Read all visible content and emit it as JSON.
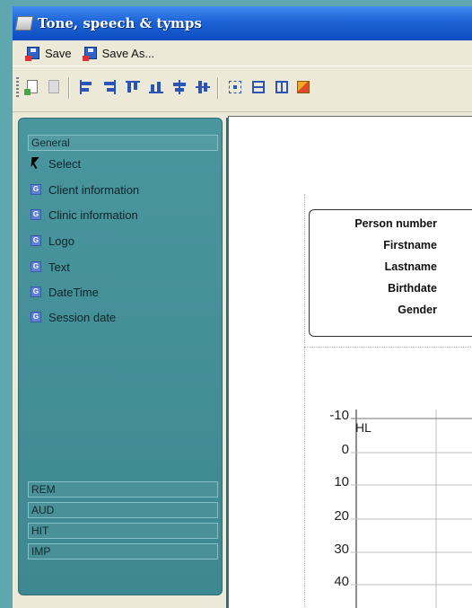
{
  "window": {
    "title": "Tone, speech & tymps"
  },
  "menu": {
    "save_label": "Save",
    "save_as_label": "Save As..."
  },
  "toolbar": {
    "buttons": [
      "new-document-icon",
      "disabled-document-icon",
      "align-left-icon",
      "align-right-icon",
      "align-top-icon",
      "align-bottom-icon",
      "center-horizontal-icon",
      "center-vertical-icon",
      "select-region-icon",
      "grid-icon",
      "columns-icon",
      "color-icon"
    ]
  },
  "panel": {
    "general_header": "General",
    "items": [
      {
        "label": "Select",
        "icon": "pointer-arrow-icon"
      },
      {
        "label": "Client information",
        "icon": "g-icon"
      },
      {
        "label": "Clinic information",
        "icon": "g-icon"
      },
      {
        "label": "Logo",
        "icon": "g-icon"
      },
      {
        "label": "Text",
        "icon": "g-icon"
      },
      {
        "label": "DateTime",
        "icon": "g-icon"
      },
      {
        "label": "Session date",
        "icon": "g-icon"
      }
    ],
    "groups": [
      "REM",
      "AUD",
      "HIT",
      "IMP"
    ]
  },
  "canvas": {
    "info_fields": [
      "Person number",
      "Firstname",
      "Lastname",
      "Birthdate",
      "Gender"
    ],
    "chart_unit": "HL",
    "y_ticks": [
      "-10",
      "0",
      "10",
      "20",
      "30",
      "40"
    ]
  },
  "colors": {
    "title_bar": "#1e63d6",
    "panel": "#4a969f",
    "background": "#5fa7ae"
  }
}
